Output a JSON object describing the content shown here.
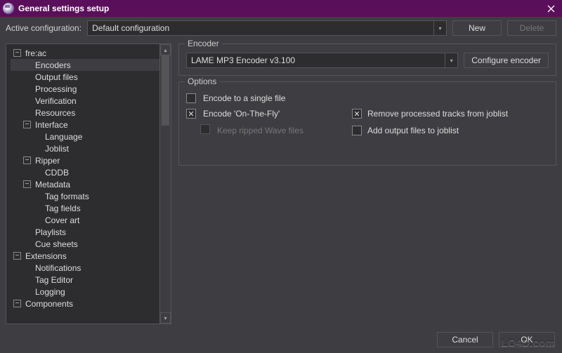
{
  "window": {
    "title": "General settings setup"
  },
  "active": {
    "label": "Active configuration:",
    "value": "Default configuration",
    "new": "New",
    "delete": "Delete"
  },
  "sidebar": {
    "items": [
      {
        "label": "fre:ac",
        "depth": 0,
        "exp": "minus"
      },
      {
        "label": "Encoders",
        "depth": 1,
        "selected": true
      },
      {
        "label": "Output files",
        "depth": 1
      },
      {
        "label": "Processing",
        "depth": 1
      },
      {
        "label": "Verification",
        "depth": 1
      },
      {
        "label": "Resources",
        "depth": 1
      },
      {
        "label": "Interface",
        "depth": 1,
        "exp": "minus"
      },
      {
        "label": "Language",
        "depth": 2
      },
      {
        "label": "Joblist",
        "depth": 2
      },
      {
        "label": "Ripper",
        "depth": 1,
        "exp": "minus"
      },
      {
        "label": "CDDB",
        "depth": 2
      },
      {
        "label": "Metadata",
        "depth": 1,
        "exp": "minus"
      },
      {
        "label": "Tag formats",
        "depth": 2
      },
      {
        "label": "Tag fields",
        "depth": 2
      },
      {
        "label": "Cover art",
        "depth": 2
      },
      {
        "label": "Playlists",
        "depth": 1
      },
      {
        "label": "Cue sheets",
        "depth": 1
      },
      {
        "label": "Extensions",
        "depth": 0,
        "exp": "minus"
      },
      {
        "label": "Notifications",
        "depth": 1
      },
      {
        "label": "Tag Editor",
        "depth": 1
      },
      {
        "label": "Logging",
        "depth": 1
      },
      {
        "label": "Components",
        "depth": 0,
        "exp": "minus"
      }
    ]
  },
  "encoder": {
    "legend": "Encoder",
    "value": "LAME MP3 Encoder v3.100",
    "configure": "Configure encoder"
  },
  "options": {
    "legend": "Options",
    "single": {
      "label": "Encode to a single file",
      "checked": false
    },
    "onthefly": {
      "label": "Encode 'On-The-Fly'",
      "checked": true
    },
    "keepwave": {
      "label": "Keep ripped Wave files",
      "checked": false,
      "disabled": true
    },
    "remove": {
      "label": "Remove processed tracks from joblist",
      "checked": true
    },
    "addout": {
      "label": "Add output files to joblist",
      "checked": false
    }
  },
  "footer": {
    "cancel": "Cancel",
    "ok": "OK"
  },
  "watermark": "LO4D.com"
}
